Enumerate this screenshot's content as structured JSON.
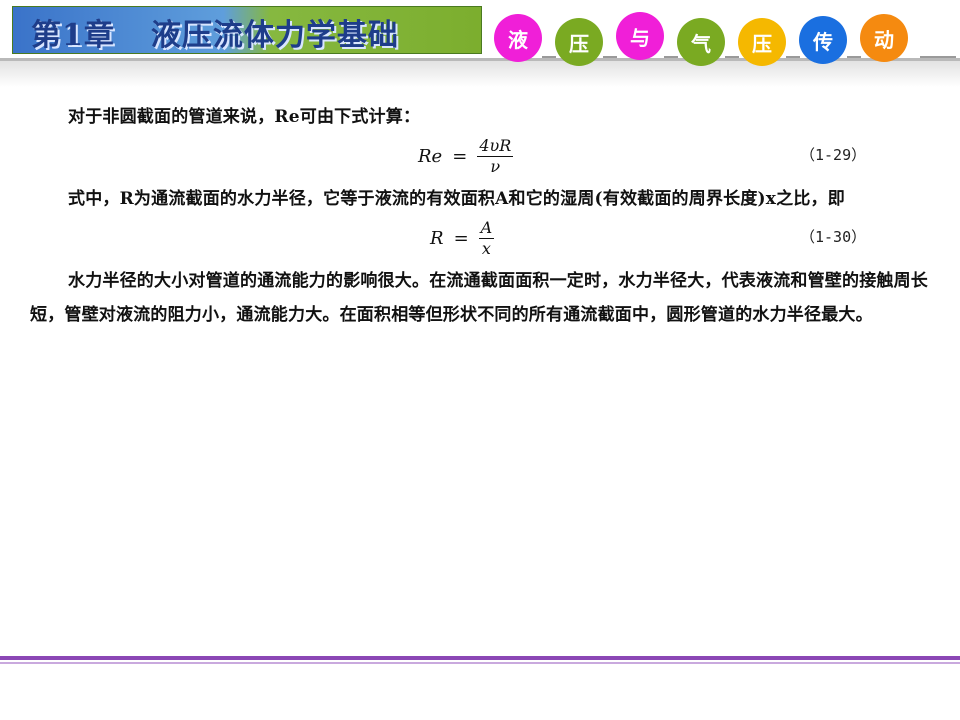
{
  "header": {
    "chapter": "第1章",
    "chapter_title": "液压流体力学基础",
    "course_chars": [
      {
        "char": "液",
        "color": "#f01fd8"
      },
      {
        "char": "压",
        "color": "#7aaa22"
      },
      {
        "char": "与",
        "color": "#f01fd8"
      },
      {
        "char": "气",
        "color": "#7aaa22"
      },
      {
        "char": "压",
        "color": "#f5b800"
      },
      {
        "char": "传",
        "color": "#1a6fe0"
      },
      {
        "char": "动",
        "color": "#f58a10"
      }
    ]
  },
  "content": {
    "p1": "对于非圆截面的管道来说，Re可由下式计算：",
    "eq1": {
      "lhs": "Re",
      "eq": "=",
      "numerator": "4υR",
      "denominator": "ν",
      "number": "（1-29）"
    },
    "p2": "式中，R为通流截面的水力半径，它等于液流的有效面积A和它的湿周(有效截面的周界长度)x之比，即",
    "eq2": {
      "lhs": "R",
      "eq": "=",
      "numerator": "A",
      "denominator": "x",
      "number": "（1-30）"
    },
    "p3": "水力半径的大小对管道的通流能力的影响很大。在流通截面面积一定时，水力半径大，代表液流和管壁的接触周长短，管壁对液流的阻力小，通流能力大。在面积相等但形状不同的所有通流截面中，圆形管道的水力半径最大。"
  }
}
